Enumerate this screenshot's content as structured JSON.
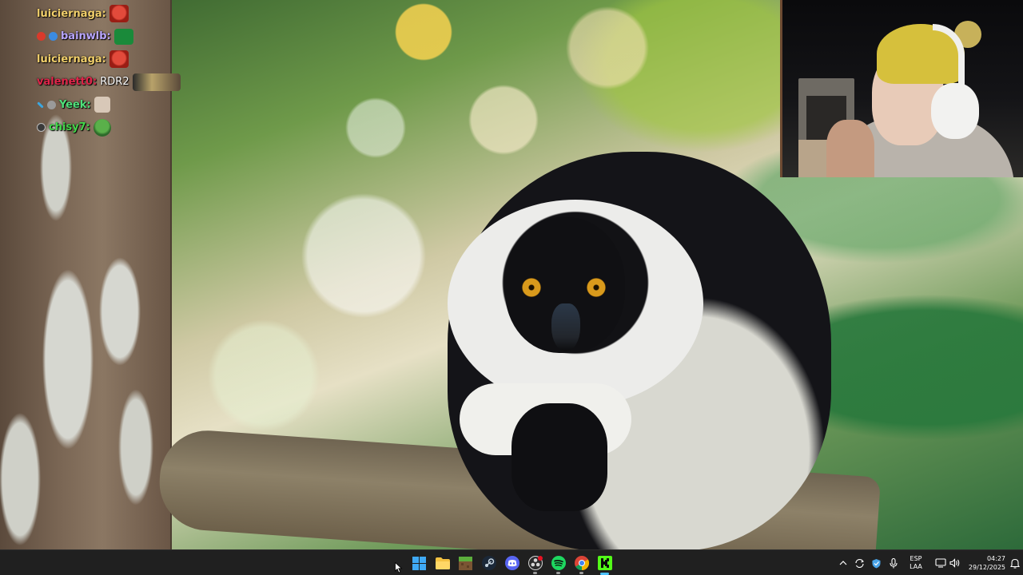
{
  "chat": {
    "messages": [
      {
        "user": "luiciernaga:",
        "user_color": "#f2d06b",
        "text": "",
        "emote": "red-mask-emote",
        "badges": []
      },
      {
        "user": "bainwlb:",
        "user_color": "#b9a6ff",
        "text": "",
        "emote": "green-box-emote",
        "badges": [
          "red-badge",
          "blue-badge"
        ]
      },
      {
        "user": "luiciernaga:",
        "user_color": "#f2d06b",
        "text": "",
        "emote": "red-mask-emote",
        "badges": []
      },
      {
        "user": "valenett0:",
        "user_color": "#e0254a",
        "text": "RDR2",
        "emote": "picture-emote",
        "badges": []
      },
      {
        "user": "Yeek:",
        "user_color": "#4fe07a",
        "text": "",
        "emote": "face-emote",
        "badges": [
          "sword-badge",
          "gray-badge"
        ]
      },
      {
        "user": "chisy7:",
        "user_color": "#43d64a",
        "text": "",
        "emote": "frog-emote",
        "badges": [
          "dark-badge"
        ]
      }
    ]
  },
  "taskbar": {
    "apps": [
      {
        "name": "start-button",
        "icon": "windows-logo-icon",
        "state": "idle"
      },
      {
        "name": "taskbar-file-explorer",
        "icon": "folder-icon",
        "state": "idle"
      },
      {
        "name": "taskbar-minecraft",
        "icon": "minecraft-block-icon",
        "state": "idle"
      },
      {
        "name": "taskbar-steam",
        "icon": "steam-icon",
        "state": "idle"
      },
      {
        "name": "taskbar-discord",
        "icon": "discord-icon",
        "state": "idle"
      },
      {
        "name": "taskbar-obs",
        "icon": "obs-icon",
        "state": "running"
      },
      {
        "name": "taskbar-spotify",
        "icon": "spotify-icon",
        "state": "running"
      },
      {
        "name": "taskbar-chrome",
        "icon": "chrome-icon",
        "state": "running"
      },
      {
        "name": "taskbar-kick",
        "icon": "kick-icon",
        "state": "active"
      }
    ],
    "tray": {
      "language_line1": "ESP",
      "language_line2": "LAA",
      "time": "04:27",
      "date": "29/12/2025"
    }
  },
  "colors": {
    "taskbar_bg": "#202020",
    "accent": "#4cc2ff"
  }
}
